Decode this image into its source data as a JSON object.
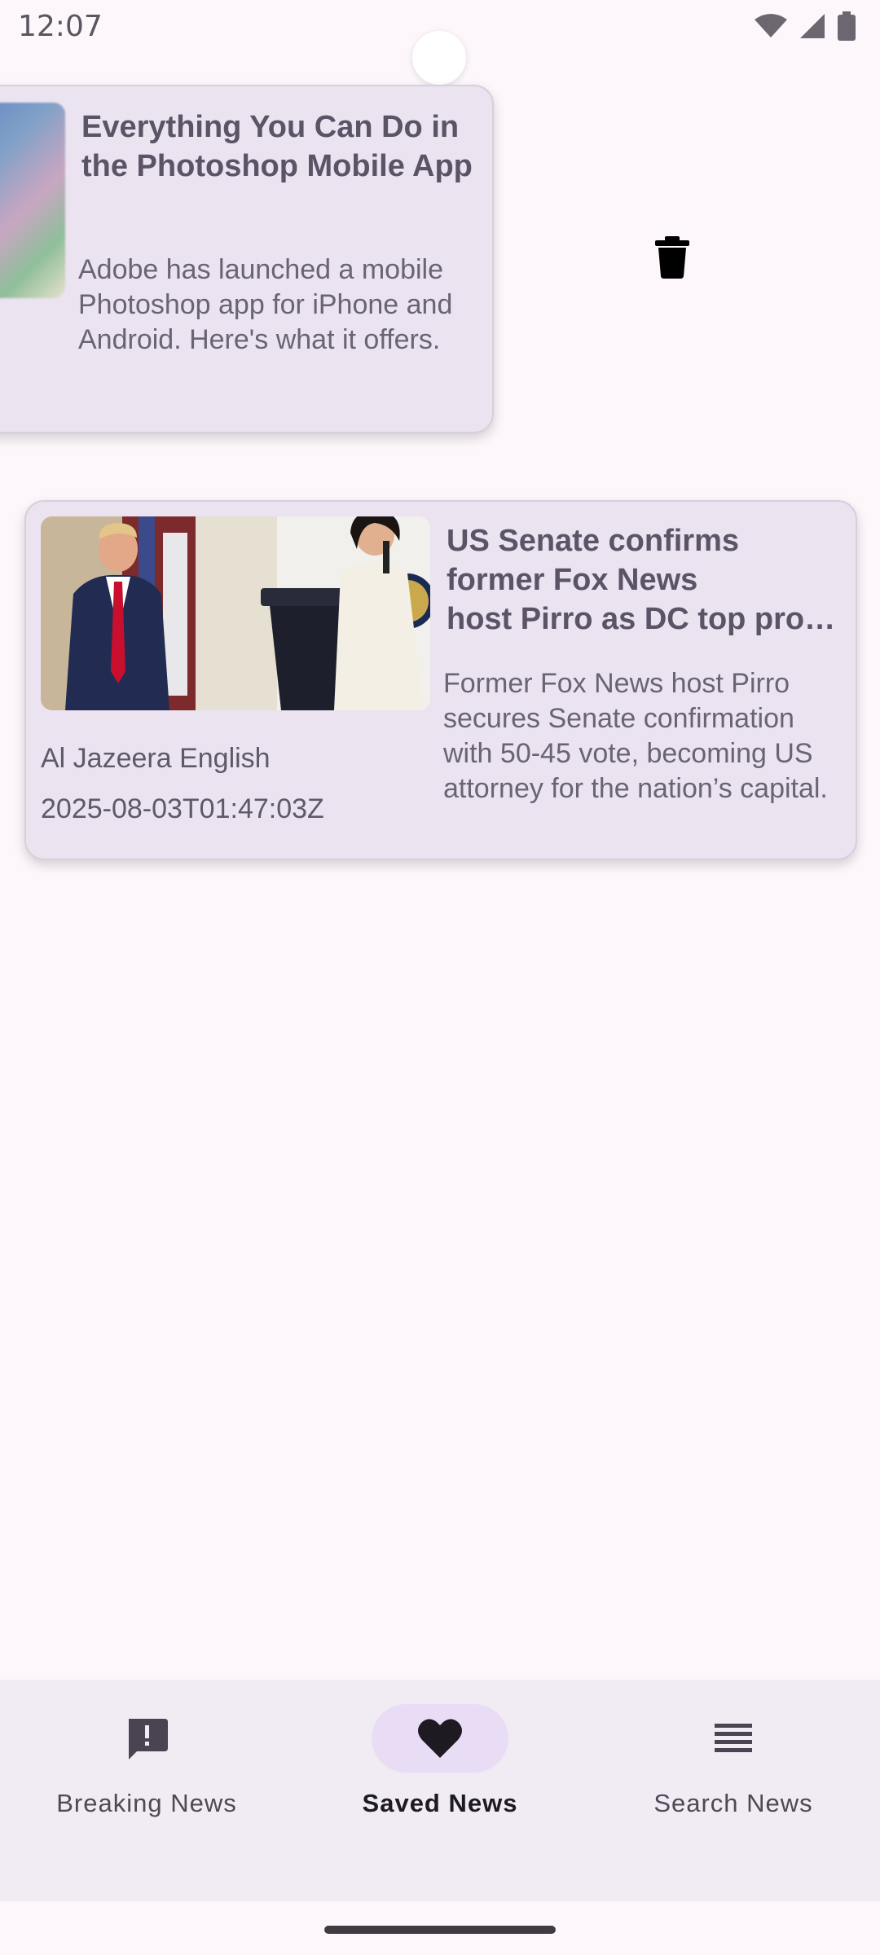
{
  "status_bar": {
    "time": "12:07",
    "icons": [
      "wifi-icon",
      "signal-icon",
      "battery-icon"
    ]
  },
  "articles": [
    {
      "title": "Everything You Can Do in the Photoshop Mobile App",
      "description": "Adobe has launched a mobile Photoshop app for iPhone and Android. Here's what it offers.",
      "swiping": true
    },
    {
      "title_lines": [
        "US Senate confirms",
        "former Fox News",
        "host Pirro as DC top pro…"
      ],
      "description": "Former Fox News host Pirro secures Senate confirmation with 50-45 vote, becoming US attorney for the nation’s capital.",
      "source": "Al Jazeera English",
      "published_at": "2025-08-03T01:47:03Z"
    }
  ],
  "swipe_action": {
    "icon": "trash-icon"
  },
  "bottom_nav": {
    "items": [
      {
        "label": "Breaking News",
        "icon": "alert-message-icon",
        "active": false
      },
      {
        "label": "Saved News",
        "icon": "heart-icon",
        "active": true
      },
      {
        "label": "Search News",
        "icon": "list-icon",
        "active": false
      }
    ]
  },
  "colors": {
    "background": "#fdf7fb",
    "card": "#ebe3f0",
    "nav_background": "#f1ebf4",
    "nav_active_pill": "#e9ddf6"
  }
}
